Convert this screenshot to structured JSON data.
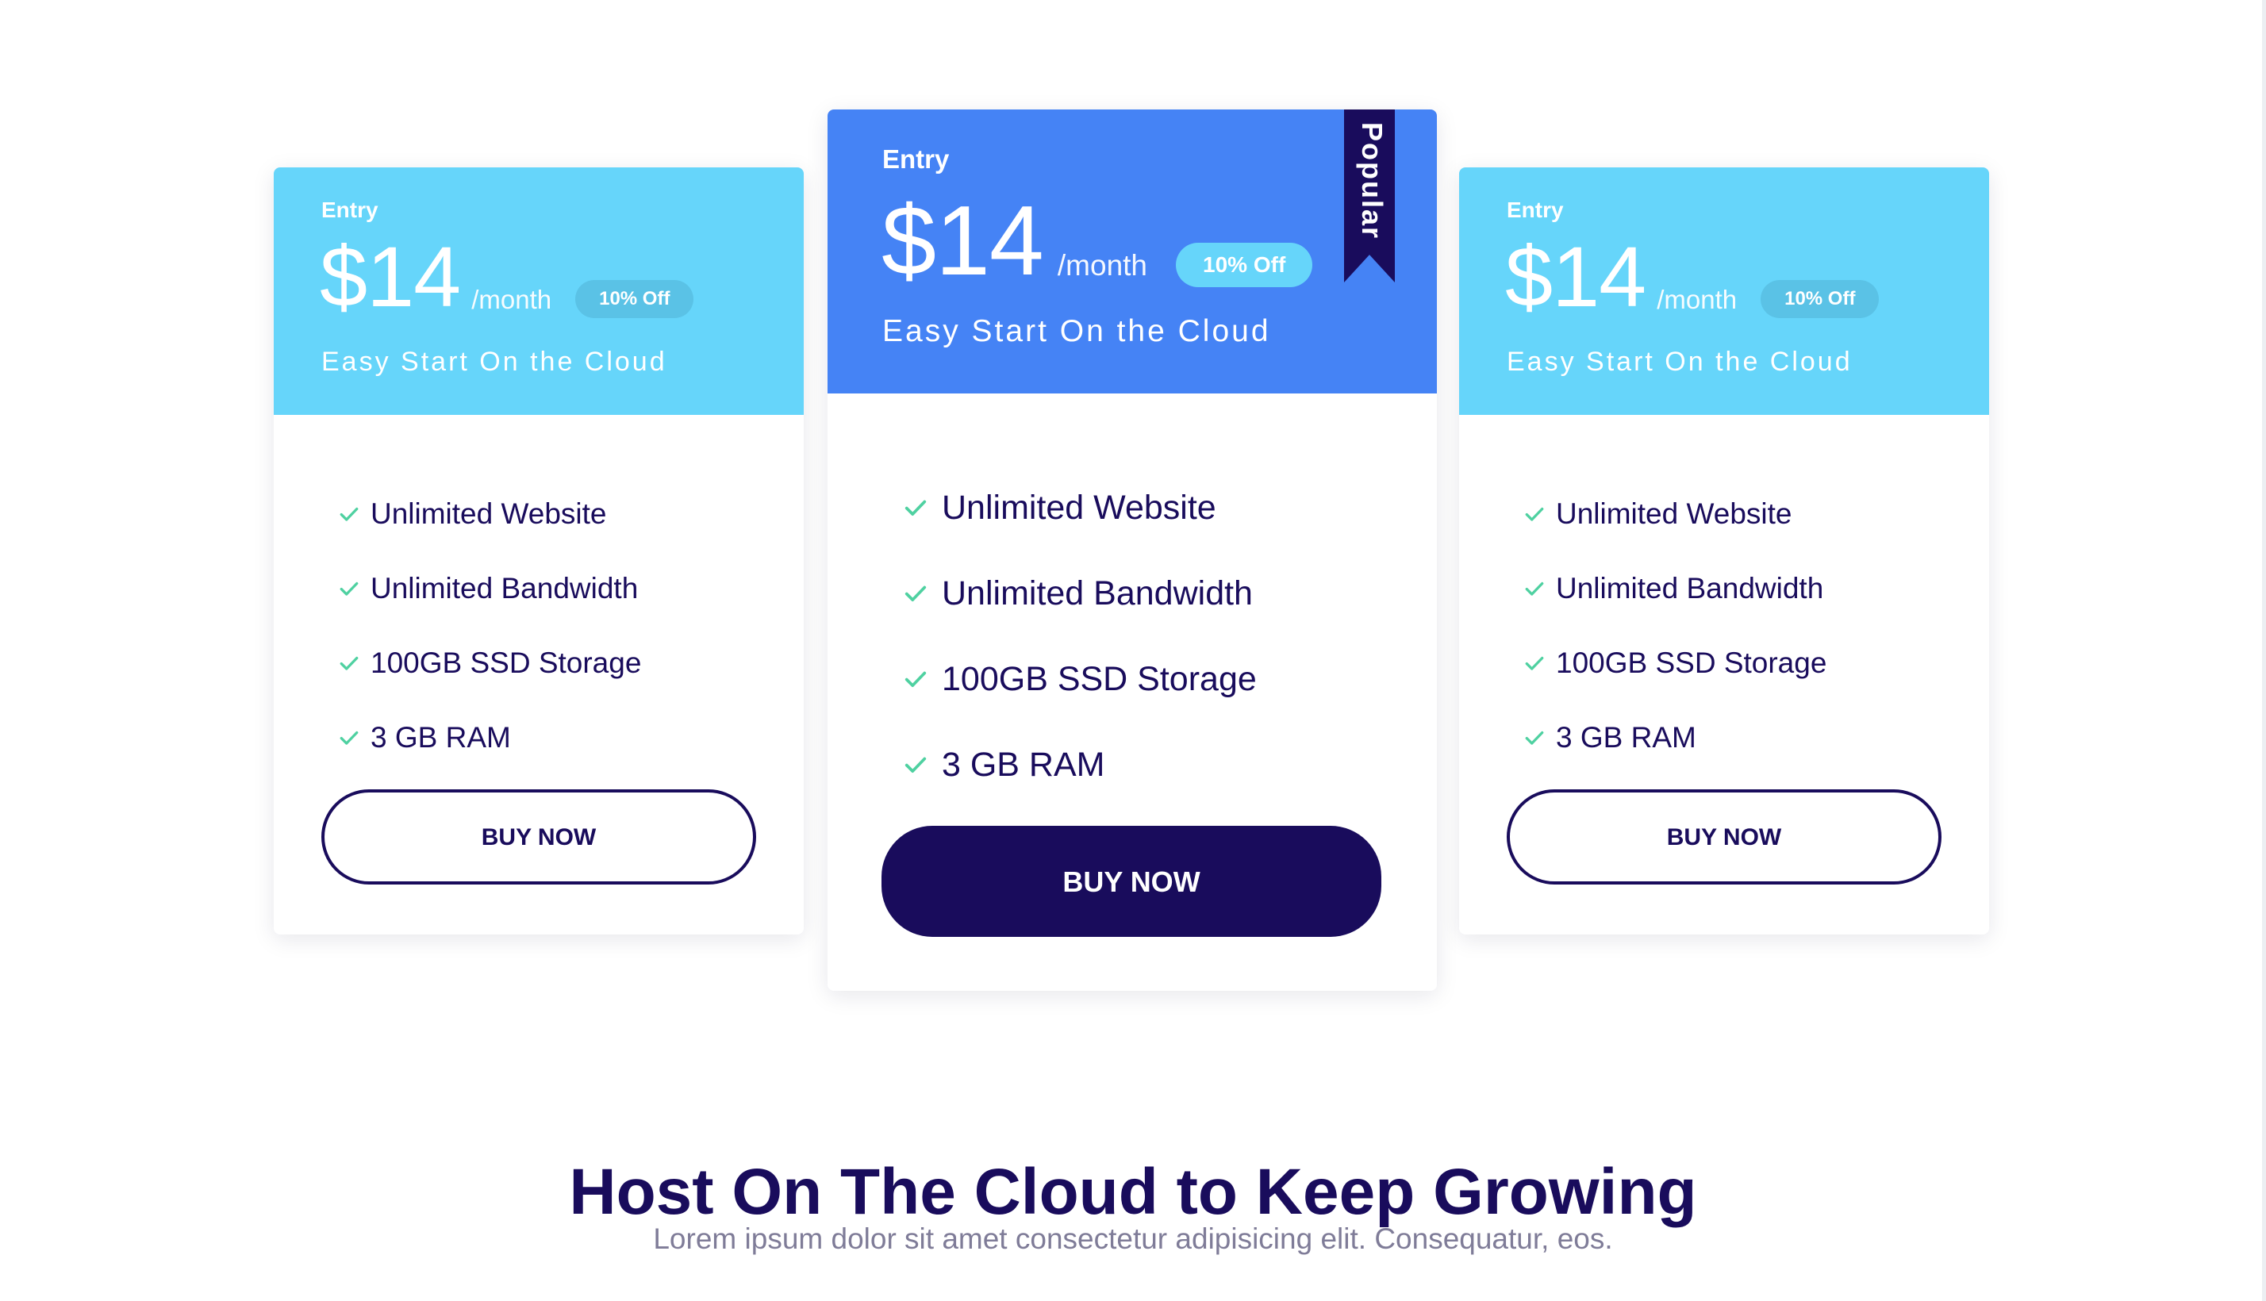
{
  "plans": [
    {
      "tier": "Entry",
      "price": "$14",
      "period": "/month",
      "discount": "10% Off",
      "tagline": "Easy Start On the Cloud",
      "features": [
        "Unlimited Website",
        "Unlimited Bandwidth",
        "100GB SSD Storage",
        "3 GB RAM"
      ],
      "button": "BUY NOW"
    },
    {
      "tier": "Entry",
      "price": "$14",
      "period": "/month",
      "discount": "10% Off",
      "tagline": "Easy Start On the Cloud",
      "ribbon": "Popular",
      "features": [
        "Unlimited Website",
        "Unlimited Bandwidth",
        "100GB SSD Storage",
        "3 GB RAM"
      ],
      "button": "BUY NOW"
    },
    {
      "tier": "Entry",
      "price": "$14",
      "period": "/month",
      "discount": "10% Off",
      "tagline": "Easy Start On the Cloud",
      "features": [
        "Unlimited Website",
        "Unlimited Bandwidth",
        "100GB SSD Storage",
        "3 GB RAM"
      ],
      "button": "BUY NOW"
    }
  ],
  "section": {
    "title": "Host On The Cloud to Keep Growing",
    "subtitle": "Lorem ipsum dolor sit amet consectetur adipisicing elit. Consequatur, eos."
  },
  "colors": {
    "side_header": "#66d5fa",
    "featured_header": "#4583f5",
    "navy": "#190c5c",
    "check": "#4fd1a1"
  },
  "icons": {
    "feature_check": "check-icon",
    "ribbon": "bookmark-ribbon"
  }
}
